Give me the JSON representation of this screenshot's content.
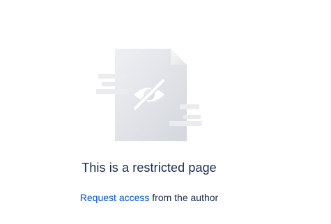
{
  "restricted": {
    "title": "This is a restricted page",
    "request_link": "Request access",
    "request_suffix": " from the author",
    "illustration_icon": "hidden-eye-document-icon"
  },
  "colors": {
    "title_text": "#172b4d",
    "link": "#0052cc",
    "illustration_page": "#dfe1e6",
    "illustration_lines": "#ebecf0"
  }
}
